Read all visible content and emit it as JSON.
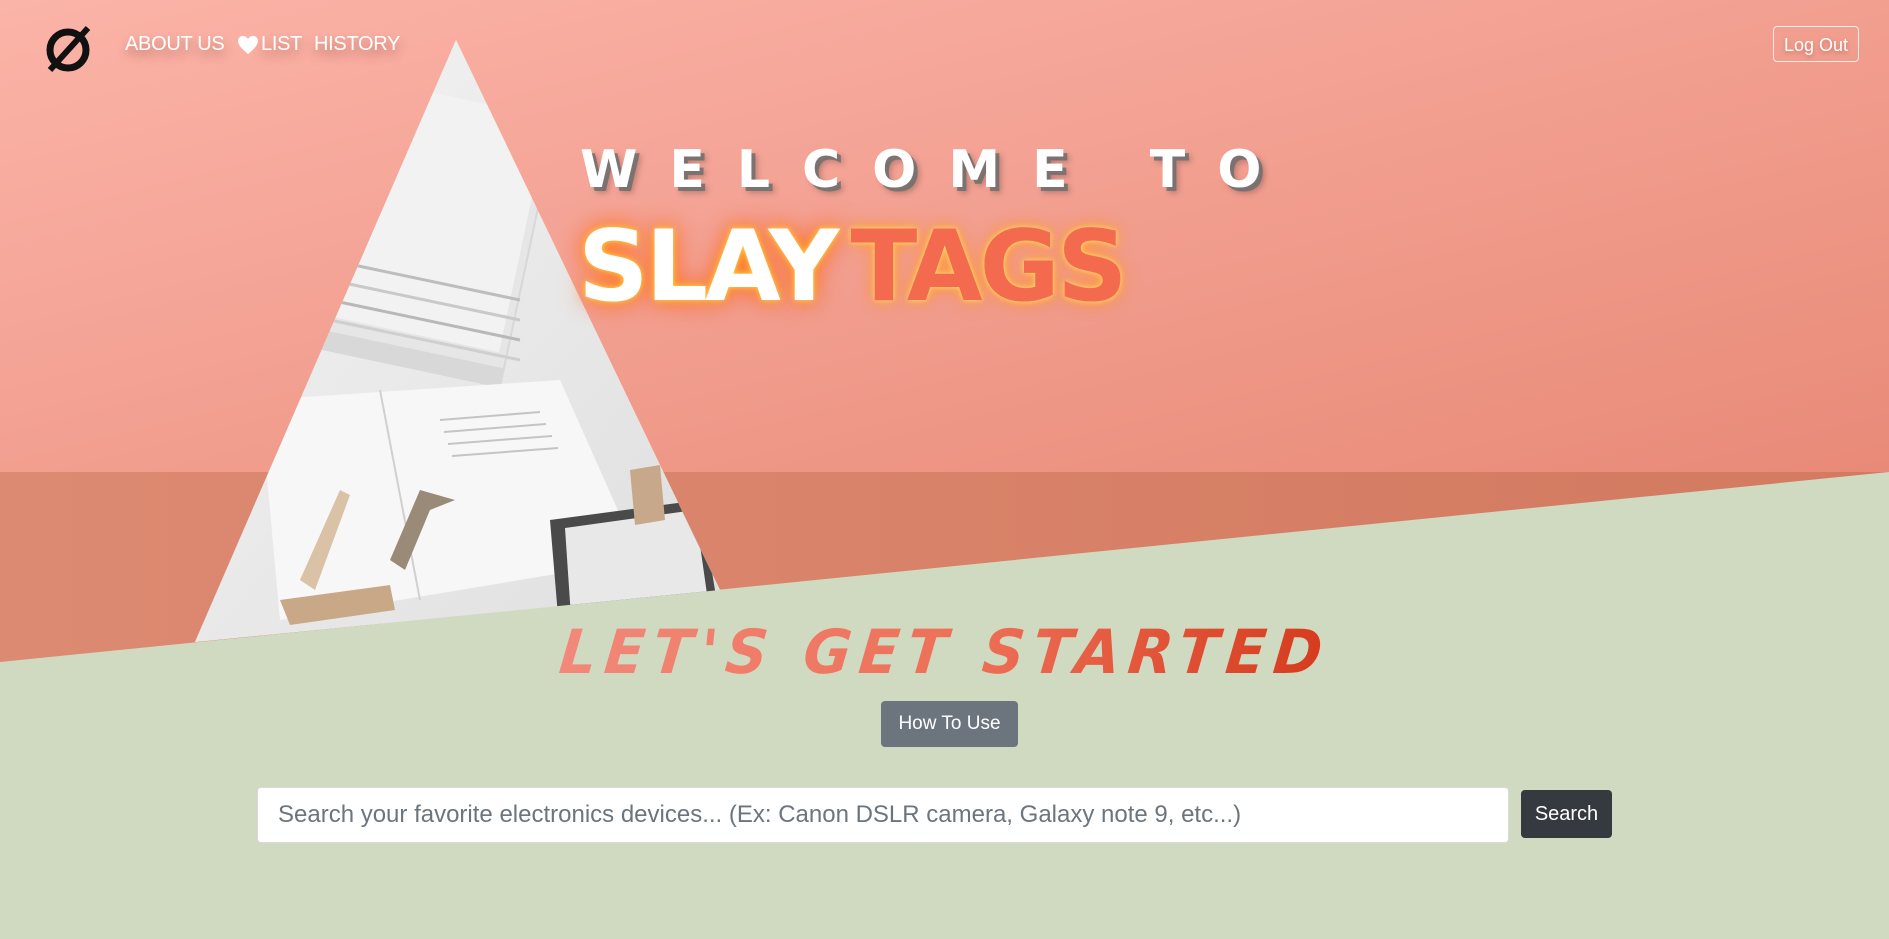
{
  "nav": {
    "about_label": "ABOUT US",
    "list_label": "LIST",
    "history_label": "HISTORY",
    "logout_label": "Log Out",
    "logo_icon": "slashed-circle-logo-icon",
    "heart_icon": "heart-icon"
  },
  "hero": {
    "welcome_text": "WELCOME TO",
    "brand_first": "SLAY",
    "brand_second": "TAGS",
    "image_icon": "desk-photo-triangle"
  },
  "main": {
    "heading": "LET'S GET STARTED",
    "how_to_label": "How To Use",
    "search_placeholder": "Search your favorite electronics devices... (Ex: Canon DSLR camera, Galaxy note 9, etc...)",
    "search_value": "",
    "search_button_label": "Search"
  },
  "colors": {
    "hero_top": "#f9b2a7",
    "hero_bottom": "#d9836a",
    "ground": "#cfdac0",
    "brand_tags": "#f46a4e",
    "button_dark": "#343a40",
    "button_gray": "#6c757d"
  }
}
